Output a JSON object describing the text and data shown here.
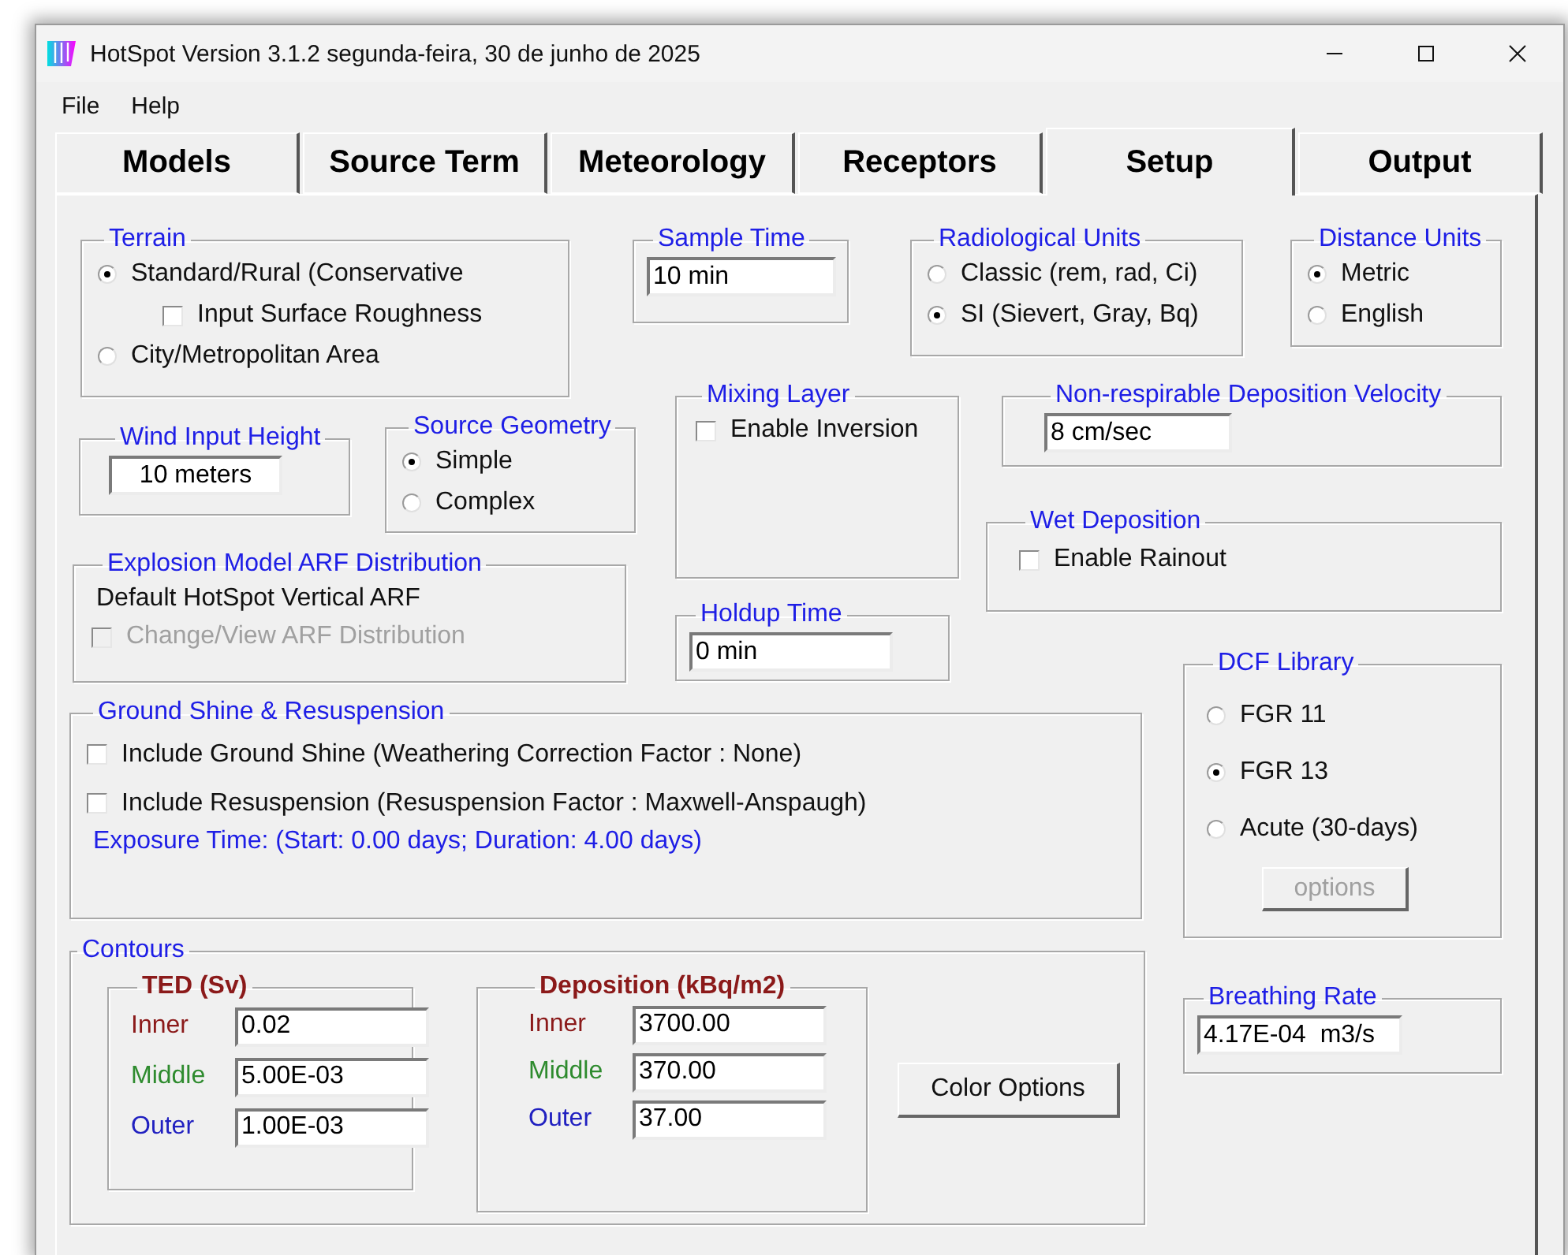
{
  "window": {
    "title": "HotSpot Version 3.1.2 segunda-feira, 30 de junho de 2025"
  },
  "menu": [
    "File",
    "Help"
  ],
  "tabs": [
    {
      "label": "Models",
      "selected": false
    },
    {
      "label": "Source Term",
      "selected": false
    },
    {
      "label": "Meteorology",
      "selected": false
    },
    {
      "label": "Receptors",
      "selected": false
    },
    {
      "label": "Setup",
      "selected": true
    },
    {
      "label": "Output",
      "selected": false
    }
  ],
  "terrain": {
    "title": "Terrain",
    "options": [
      {
        "label": "Standard/Rural (Conservative",
        "selected": true
      },
      {
        "label": "City/Metropolitan Area",
        "selected": false
      }
    ],
    "roughness": {
      "label": "Input Surface Roughness",
      "checked": false
    }
  },
  "sample_time": {
    "title": "Sample Time",
    "value": "10 min"
  },
  "radiological_units": {
    "title": "Radiological Units",
    "options": [
      {
        "label": "Classic (rem, rad, Ci)",
        "selected": false
      },
      {
        "label": "SI (Sievert,  Gray, Bq)",
        "selected": true
      }
    ]
  },
  "distance_units": {
    "title": "Distance Units",
    "options": [
      {
        "label": "Metric",
        "selected": true
      },
      {
        "label": "English",
        "selected": false
      }
    ]
  },
  "wind_input_height": {
    "title": "Wind Input Height",
    "value": "10 meters"
  },
  "source_geometry": {
    "title": "Source Geometry",
    "options": [
      {
        "label": "Simple",
        "selected": true
      },
      {
        "label": "Complex",
        "selected": false
      }
    ]
  },
  "mixing_layer": {
    "title": "Mixing Layer",
    "checkbox": {
      "label": "Enable Inversion",
      "checked": false
    }
  },
  "non_respirable_deposition_velocity": {
    "title": "Non-respirable Deposition Velocity",
    "value": "8 cm/sec"
  },
  "wet_deposition": {
    "title": "Wet Deposition",
    "checkbox": {
      "label": "Enable Rainout",
      "checked": false
    }
  },
  "explosion_model": {
    "title": "Explosion Model ARF Distribution",
    "text": "Default HotSpot Vertical ARF",
    "checkbox": {
      "label": "Change/View ARF Distribution",
      "checked": false,
      "disabled": true
    }
  },
  "holdup_time": {
    "title": "Holdup Time",
    "value": "0 min"
  },
  "dcf_library": {
    "title": "DCF Library",
    "options": [
      {
        "label": "FGR 11",
        "selected": false
      },
      {
        "label": "FGR 13",
        "selected": true
      },
      {
        "label": "Acute (30-days)",
        "selected": false
      }
    ],
    "button": {
      "label": "options",
      "disabled": true
    }
  },
  "ground_shine": {
    "title": "Ground Shine & Resuspension",
    "checkboxes": [
      {
        "label": "Include Ground Shine (Weathering Correction Factor : None)",
        "checked": false
      },
      {
        "label": "Include Resuspension (Resuspension Factor : Maxwell-Anspaugh)",
        "checked": false
      }
    ],
    "note": "Exposure Time: (Start: 0.00 days; Duration: 4.00 days)"
  },
  "contours": {
    "title": "Contours",
    "groups": [
      {
        "title": "TED (Sv)",
        "rows": [
          {
            "label": "Inner",
            "value": "0.02",
            "color": "#8b1a1a"
          },
          {
            "label": "Middle",
            "value": "5.00E-03",
            "color": "#2e8b2e"
          },
          {
            "label": "Outer",
            "value": "1.00E-03",
            "color": "#2020c0"
          }
        ]
      },
      {
        "title": "Deposition (kBq/m2)",
        "rows": [
          {
            "label": "Inner",
            "value": "3700.00",
            "color": "#8b1a1a"
          },
          {
            "label": "Middle",
            "value": "370.00",
            "color": "#2e8b2e"
          },
          {
            "label": "Outer",
            "value": "37.00",
            "color": "#2020c0"
          }
        ]
      }
    ],
    "button": "Color Options"
  },
  "breathing_rate": {
    "title": "Breathing Rate",
    "value": "4.17E-04  m3/s"
  }
}
